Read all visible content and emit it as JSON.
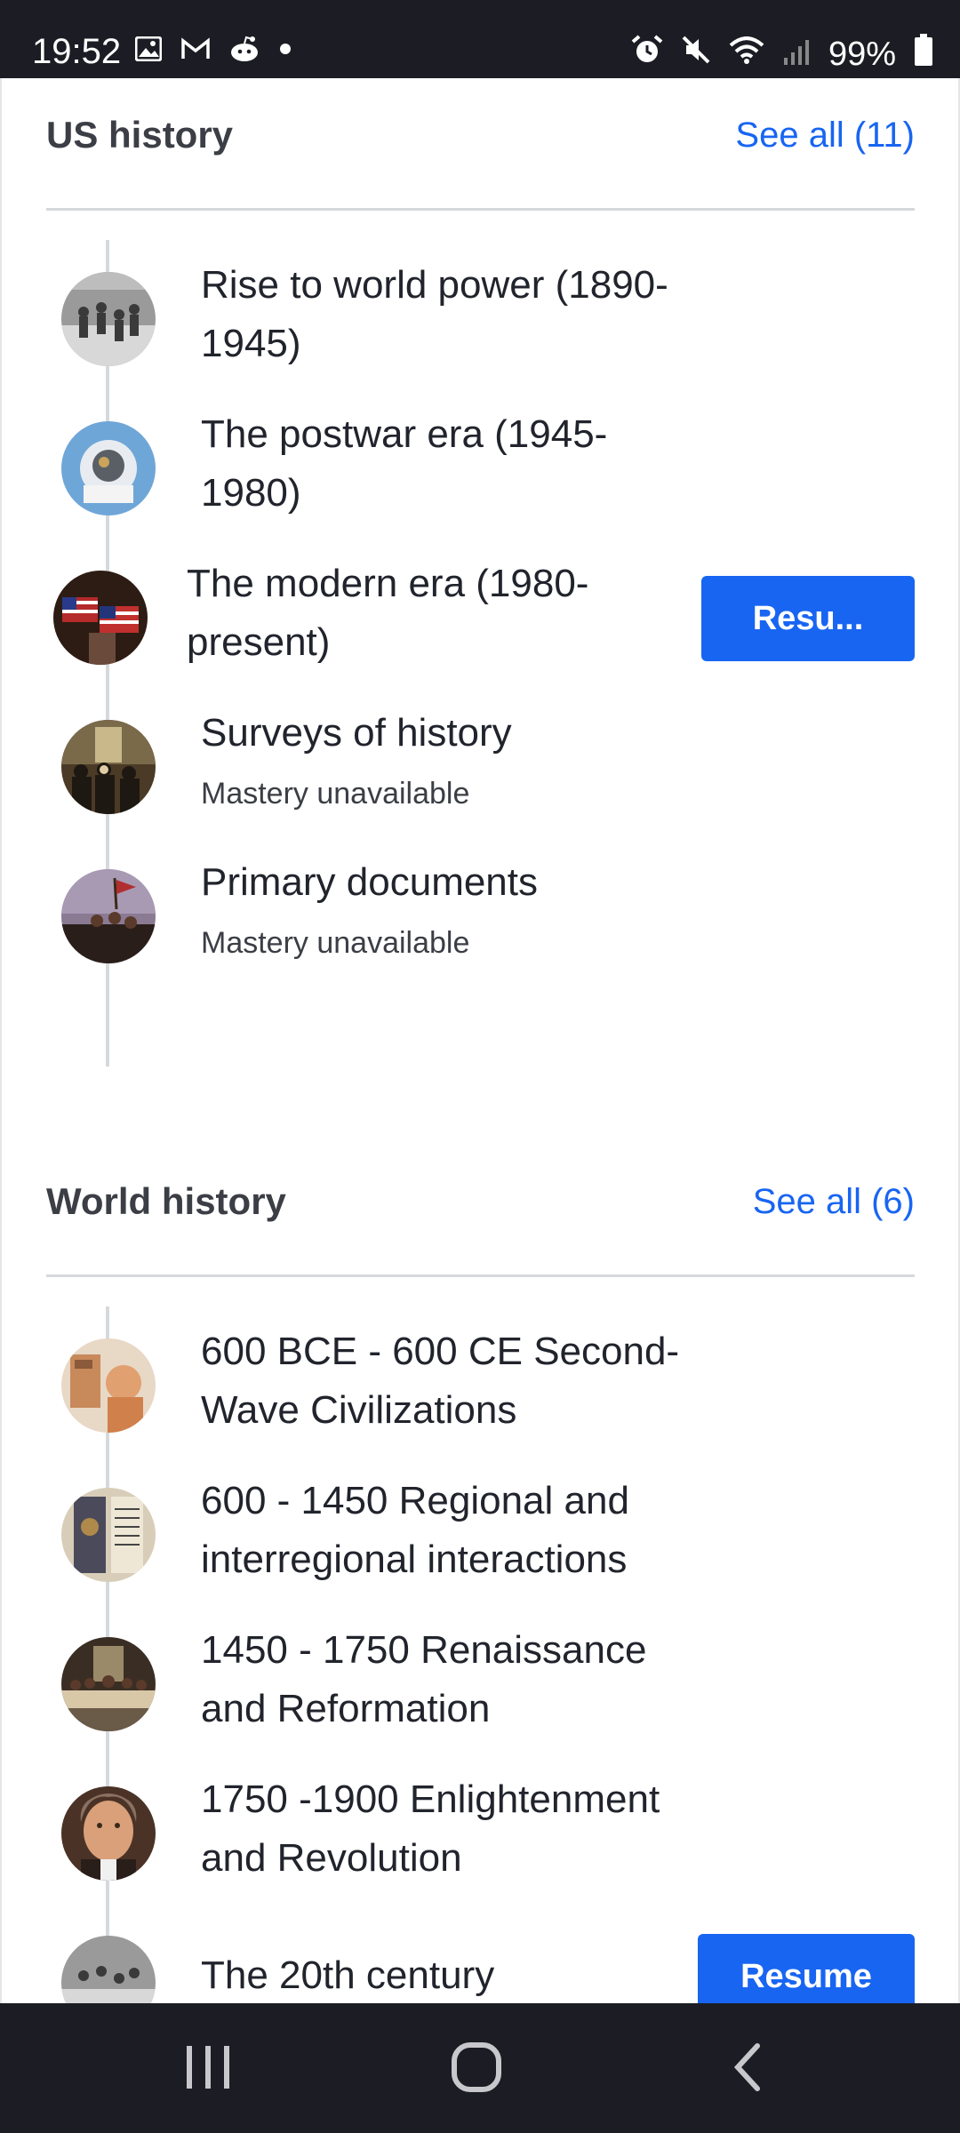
{
  "status_bar": {
    "time": "19:52",
    "left_icons": [
      "gallery-icon",
      "gmail-icon",
      "reddit-icon",
      "dot-icon"
    ],
    "right_icons": [
      "alarm-icon",
      "mute-icon",
      "wifi-icon",
      "signal-icon"
    ],
    "battery": "99%"
  },
  "us_history": {
    "title": "US history",
    "see_all": "See all (11)",
    "items": [
      {
        "title": "Rise to world power (1890-1945)",
        "subtitle": ""
      },
      {
        "title": "The postwar era (1945-1980)",
        "subtitle": ""
      },
      {
        "title": "The modern era (1980-present)",
        "subtitle": "",
        "button": "Resu..."
      },
      {
        "title": "Surveys of history",
        "subtitle": "Mastery unavailable"
      },
      {
        "title": "Primary documents",
        "subtitle": "Mastery unavailable"
      }
    ]
  },
  "world_history": {
    "title": "World history",
    "see_all": "See all (6)",
    "items": [
      {
        "title": "600 BCE - 600 CE Second-Wave Civilizations"
      },
      {
        "title": "600 - 1450 Regional and interregional interactions"
      },
      {
        "title": "1450 - 1750 Renaissance and Reformation"
      },
      {
        "title": "1750 -1900 Enlightenment and Revolution"
      },
      {
        "title": "The 20th century",
        "button": "Resume"
      }
    ]
  },
  "nav_bar": {
    "buttons": [
      "recent-apps-icon",
      "home-icon",
      "back-icon"
    ]
  },
  "colors": {
    "accent": "#1865f2",
    "text": "#21242c",
    "system_bar": "#1c1d24"
  }
}
